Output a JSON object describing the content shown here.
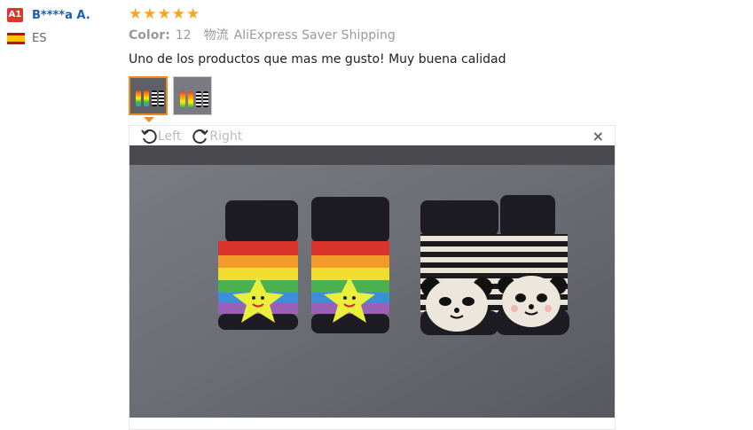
{
  "reviewer": {
    "level_badge": "A1",
    "name": "B****a A.",
    "country_code": "ES",
    "flag": "spain-flag"
  },
  "review": {
    "rating": 5,
    "color_label": "Color:",
    "color_value": "12",
    "shipping_label": "物流",
    "shipping_value": "AliExpress Saver Shipping",
    "text": "Uno de los productos que mas me gusto! Muy buena calidad"
  },
  "thumbnails": [
    {
      "name": "photo-1",
      "active": true
    },
    {
      "name": "photo-2",
      "active": false
    }
  ],
  "viewer": {
    "rotate_left_label": "Left",
    "rotate_right_label": "Right",
    "close_symbol": "×"
  },
  "colors": {
    "star": "#f5a623",
    "accent": "#f08a24",
    "link": "#1a5fb4",
    "badge": "#e0352b"
  }
}
